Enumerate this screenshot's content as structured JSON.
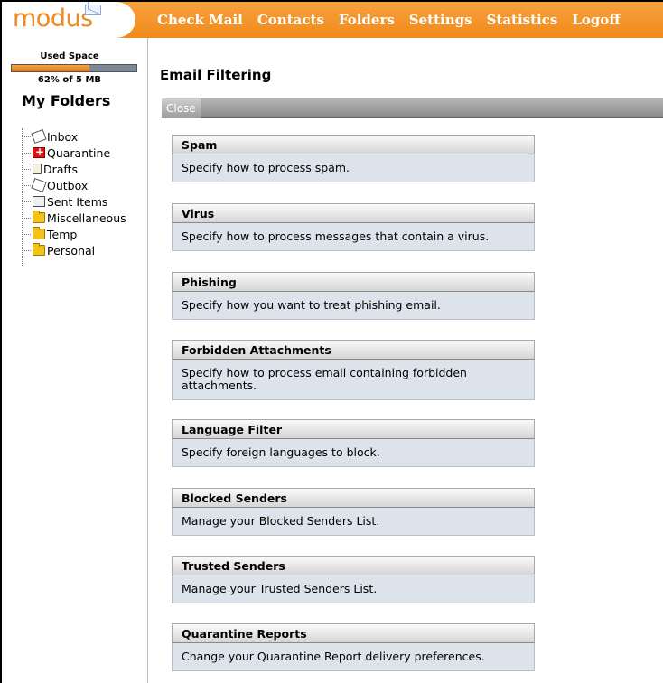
{
  "app": {
    "logo": "modus",
    "nav": [
      "Check Mail",
      "Contacts",
      "Folders",
      "Settings",
      "Statistics",
      "Logoff"
    ]
  },
  "sidebar": {
    "used_space_label": "Used Space",
    "used_space_fraction": 0.62,
    "used_space_text": "62% of 5 MB",
    "title": "My Folders",
    "folders": [
      {
        "label": "Inbox",
        "icon": "inbox-icon"
      },
      {
        "label": "Quarantine",
        "icon": "quarantine-icon"
      },
      {
        "label": "Drafts",
        "icon": "drafts-icon"
      },
      {
        "label": "Outbox",
        "icon": "outbox-icon"
      },
      {
        "label": "Sent Items",
        "icon": "sent-items-icon"
      },
      {
        "label": "Miscellaneous",
        "icon": "folder-icon"
      },
      {
        "label": "Temp",
        "icon": "folder-icon"
      },
      {
        "label": "Personal",
        "icon": "folder-icon"
      }
    ]
  },
  "main": {
    "title": "Email Filtering",
    "close_label": "Close",
    "sections": [
      {
        "title": "Spam",
        "description": "Specify how to process spam."
      },
      {
        "title": "Virus",
        "description": "Specify how to process messages that contain a virus."
      },
      {
        "title": "Phishing",
        "description": "Specify how you want to treat phishing email."
      },
      {
        "title": "Forbidden Attachments",
        "description": "Specify how to process email containing forbidden attachments."
      },
      {
        "title": "Language Filter",
        "description": "Specify foreign languages to block."
      },
      {
        "title": "Blocked Senders",
        "description": "Manage your Blocked Senders List."
      },
      {
        "title": "Trusted Senders",
        "description": "Manage your Trusted Senders List."
      },
      {
        "title": "Quarantine Reports",
        "description": "Change your Quarantine Report delivery preferences."
      }
    ]
  },
  "colors": {
    "brand_orange": "#f08a1c",
    "card_body": "#dce3ea"
  }
}
